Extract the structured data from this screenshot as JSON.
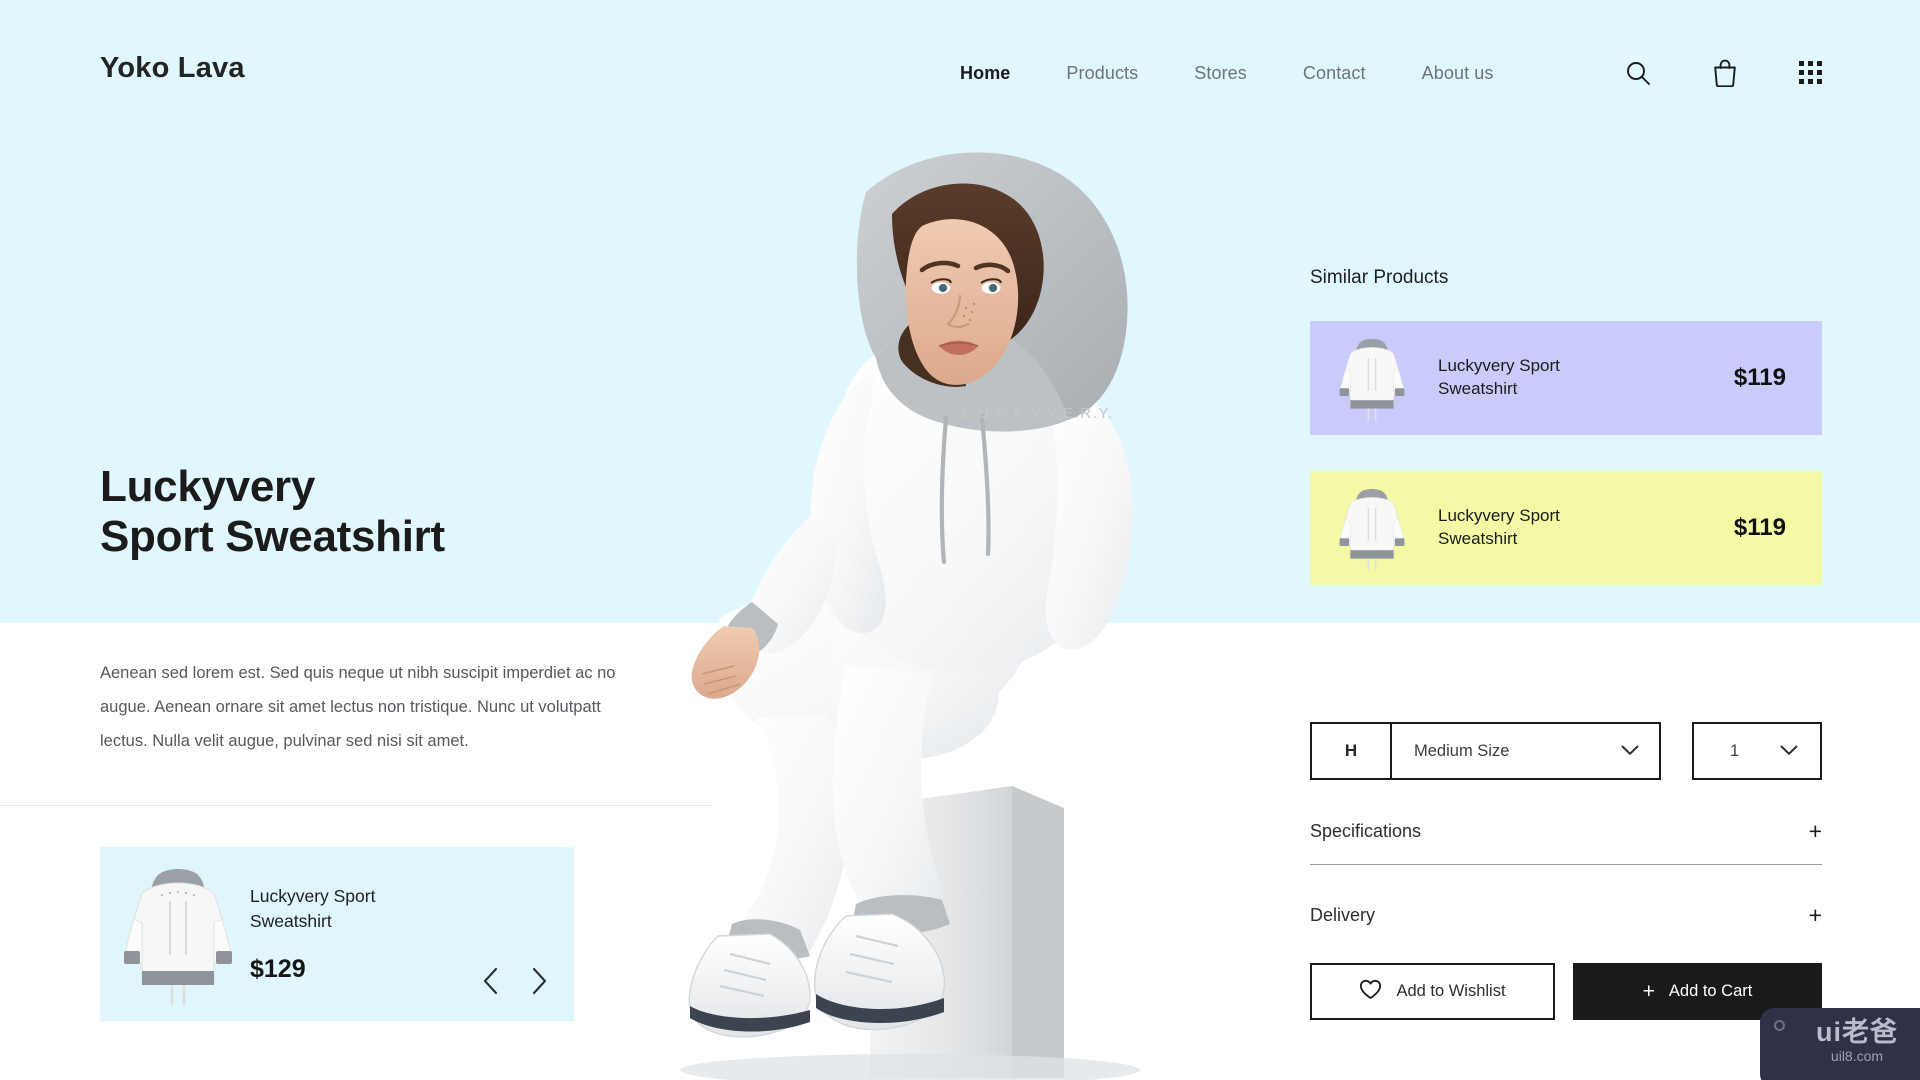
{
  "header": {
    "logo": "Yoko Lava",
    "nav": [
      {
        "label": "Home",
        "active": true
      },
      {
        "label": "Products",
        "active": false
      },
      {
        "label": "Stores",
        "active": false
      },
      {
        "label": "Contact",
        "active": false
      },
      {
        "label": "About us",
        "active": false
      }
    ],
    "icons": [
      "search-icon",
      "shopping-bag-icon",
      "grid-menu-icon"
    ]
  },
  "hero": {
    "title_line1": "Luckyvery",
    "title_line2": "Sport Sweatshirt",
    "description": "Aenean sed lorem est. Sed quis neque ut nibh suscipit imperdiet ac no augue. Aenean ornare sit amet lectus non tristique. Nunc ut volutpatt lectus. Nulla velit augue, pulvinar sed nisi sit amet.",
    "model_garment_text": "L.U.C.K.Y.V.E.R.Y."
  },
  "featured_product": {
    "name": "Luckyvery Sport Sweatshirt",
    "price": "$129",
    "prev_label": "‹",
    "next_label": "›",
    "bg_color": "#DFF6FC"
  },
  "similar": {
    "heading": "Similar Products",
    "items": [
      {
        "name": "Luckyvery Sport Sweatshirt",
        "price": "$119",
        "bg_color": "#C9CCFA"
      },
      {
        "name": "Luckyvery Sport Sweatshirt",
        "price": "$119",
        "bg_color": "#F4F9A6"
      }
    ]
  },
  "options": {
    "size_prefix": "H",
    "size_value": "Medium Size",
    "quantity_value": "1"
  },
  "accordions": [
    {
      "label": "Specifications",
      "toggle": "+"
    },
    {
      "label": "Delivery",
      "toggle": "+"
    }
  ],
  "actions": {
    "wishlist_label": "Add to Wishlist",
    "cart_label": "Add to Cart",
    "cart_plus": "+"
  },
  "watermark": {
    "main": "ui老爸",
    "sub": "uil8.com"
  },
  "colors": {
    "hero_bg": "#E0F8FD",
    "page_bg": "#FFFFFF",
    "ink": "#1B1B1B",
    "muted": "#6E7377",
    "cart_bg": "#1A1A1A"
  }
}
